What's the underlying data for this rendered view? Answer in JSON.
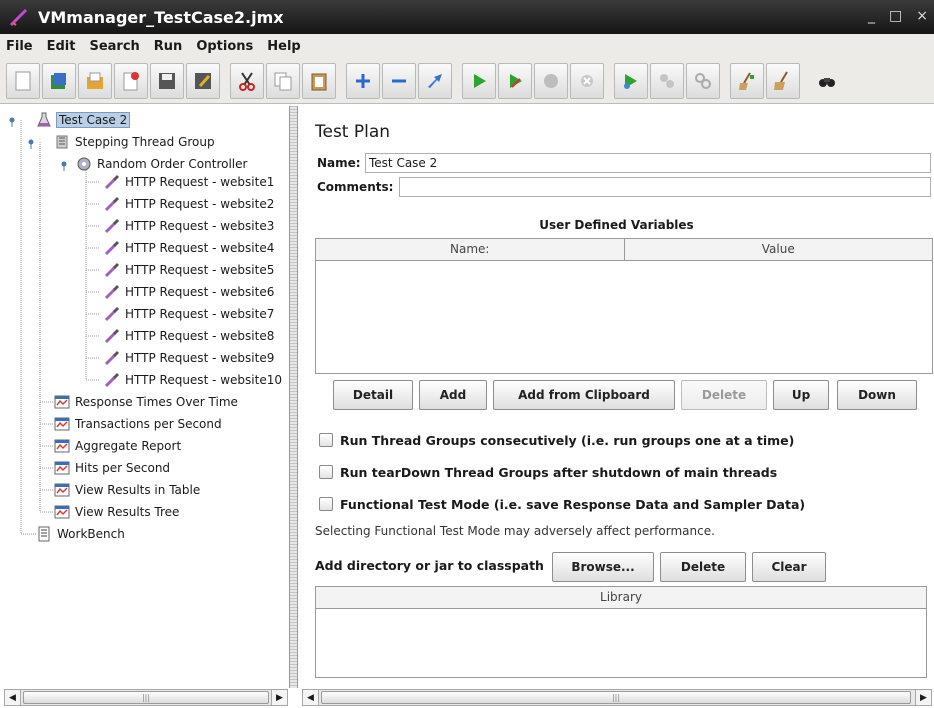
{
  "window": {
    "title": "VMmanager_TestCase2.jmx",
    "controls": [
      "_",
      "□",
      "×"
    ]
  },
  "menu": [
    {
      "label": "File"
    },
    {
      "label": "Edit"
    },
    {
      "label": "Search"
    },
    {
      "label": "Run"
    },
    {
      "label": "Options"
    },
    {
      "label": "Help"
    }
  ],
  "toolbar_icons": [
    "new-icon",
    "templates-icon",
    "open-icon",
    "close-icon",
    "save-icon",
    "save-as-icon",
    "cut-icon",
    "copy-icon",
    "paste-icon",
    "expand-icon",
    "collapse-icon",
    "toggle-icon",
    "start-icon",
    "start-no-pauses-icon",
    "stop-icon",
    "shutdown-icon",
    "remote-start-icon",
    "remote-stop-icon",
    "remote-shutdown-icon",
    "clear-icon",
    "clear-all-icon",
    "search-icon"
  ],
  "tree": {
    "items": [
      {
        "label": "Test Case 2",
        "icon": "flask-icon"
      },
      {
        "label": "Stepping Thread Group",
        "icon": "thread-group-icon"
      },
      {
        "label": "Random Order Controller",
        "icon": "controller-icon"
      },
      {
        "label": "HTTP Request - website1",
        "icon": "pipette-icon"
      },
      {
        "label": "HTTP Request - website2",
        "icon": "pipette-icon"
      },
      {
        "label": "HTTP Request - website3",
        "icon": "pipette-icon"
      },
      {
        "label": "HTTP Request - website4",
        "icon": "pipette-icon"
      },
      {
        "label": "HTTP Request - website5",
        "icon": "pipette-icon"
      },
      {
        "label": "HTTP Request - website6",
        "icon": "pipette-icon"
      },
      {
        "label": "HTTP Request - website7",
        "icon": "pipette-icon"
      },
      {
        "label": "HTTP Request - website8",
        "icon": "pipette-icon"
      },
      {
        "label": "HTTP Request - website9",
        "icon": "pipette-icon"
      },
      {
        "label": "HTTP Request - website10",
        "icon": "pipette-icon"
      },
      {
        "label": "Response Times Over Time",
        "icon": "listener-icon"
      },
      {
        "label": "Transactions per Second",
        "icon": "listener-icon"
      },
      {
        "label": "Aggregate Report",
        "icon": "listener-icon"
      },
      {
        "label": "Hits per Second",
        "icon": "listener-icon"
      },
      {
        "label": "View Results in Table",
        "icon": "listener-icon"
      },
      {
        "label": "View Results Tree",
        "icon": "listener-icon"
      },
      {
        "label": "WorkBench",
        "icon": "workbench-icon"
      }
    ]
  },
  "test_plan": {
    "title": "Test Plan",
    "name_label": "Name:",
    "name_value": "Test Case 2",
    "comments_label": "Comments:",
    "comments_value": "",
    "udv_title": "User Defined Variables",
    "udv_columns": [
      "Name:",
      "Value"
    ],
    "buttons": {
      "detail": "Detail",
      "add": "Add",
      "add_clipboard": "Add from Clipboard",
      "delete": "Delete",
      "up": "Up",
      "down": "Down"
    },
    "checkboxes": [
      {
        "label": "Run Thread Groups consecutively (i.e. run groups one at a time)",
        "checked": false
      },
      {
        "label": "Run tearDown Thread Groups after shutdown of main threads",
        "checked": false
      },
      {
        "label": "Functional Test Mode (i.e. save Response Data and Sampler Data)",
        "checked": false
      }
    ],
    "functional_note": "Selecting Functional Test Mode may adversely affect performance.",
    "classpath_label": "Add directory or jar to classpath",
    "classpath_buttons": {
      "browse": "Browse...",
      "delete": "Delete",
      "clear": "Clear"
    },
    "library_column": "Library"
  },
  "colors": {
    "titlebar": "#1e1e1e",
    "selection": "#b8cfe5",
    "chrome": "#ecebe8"
  }
}
